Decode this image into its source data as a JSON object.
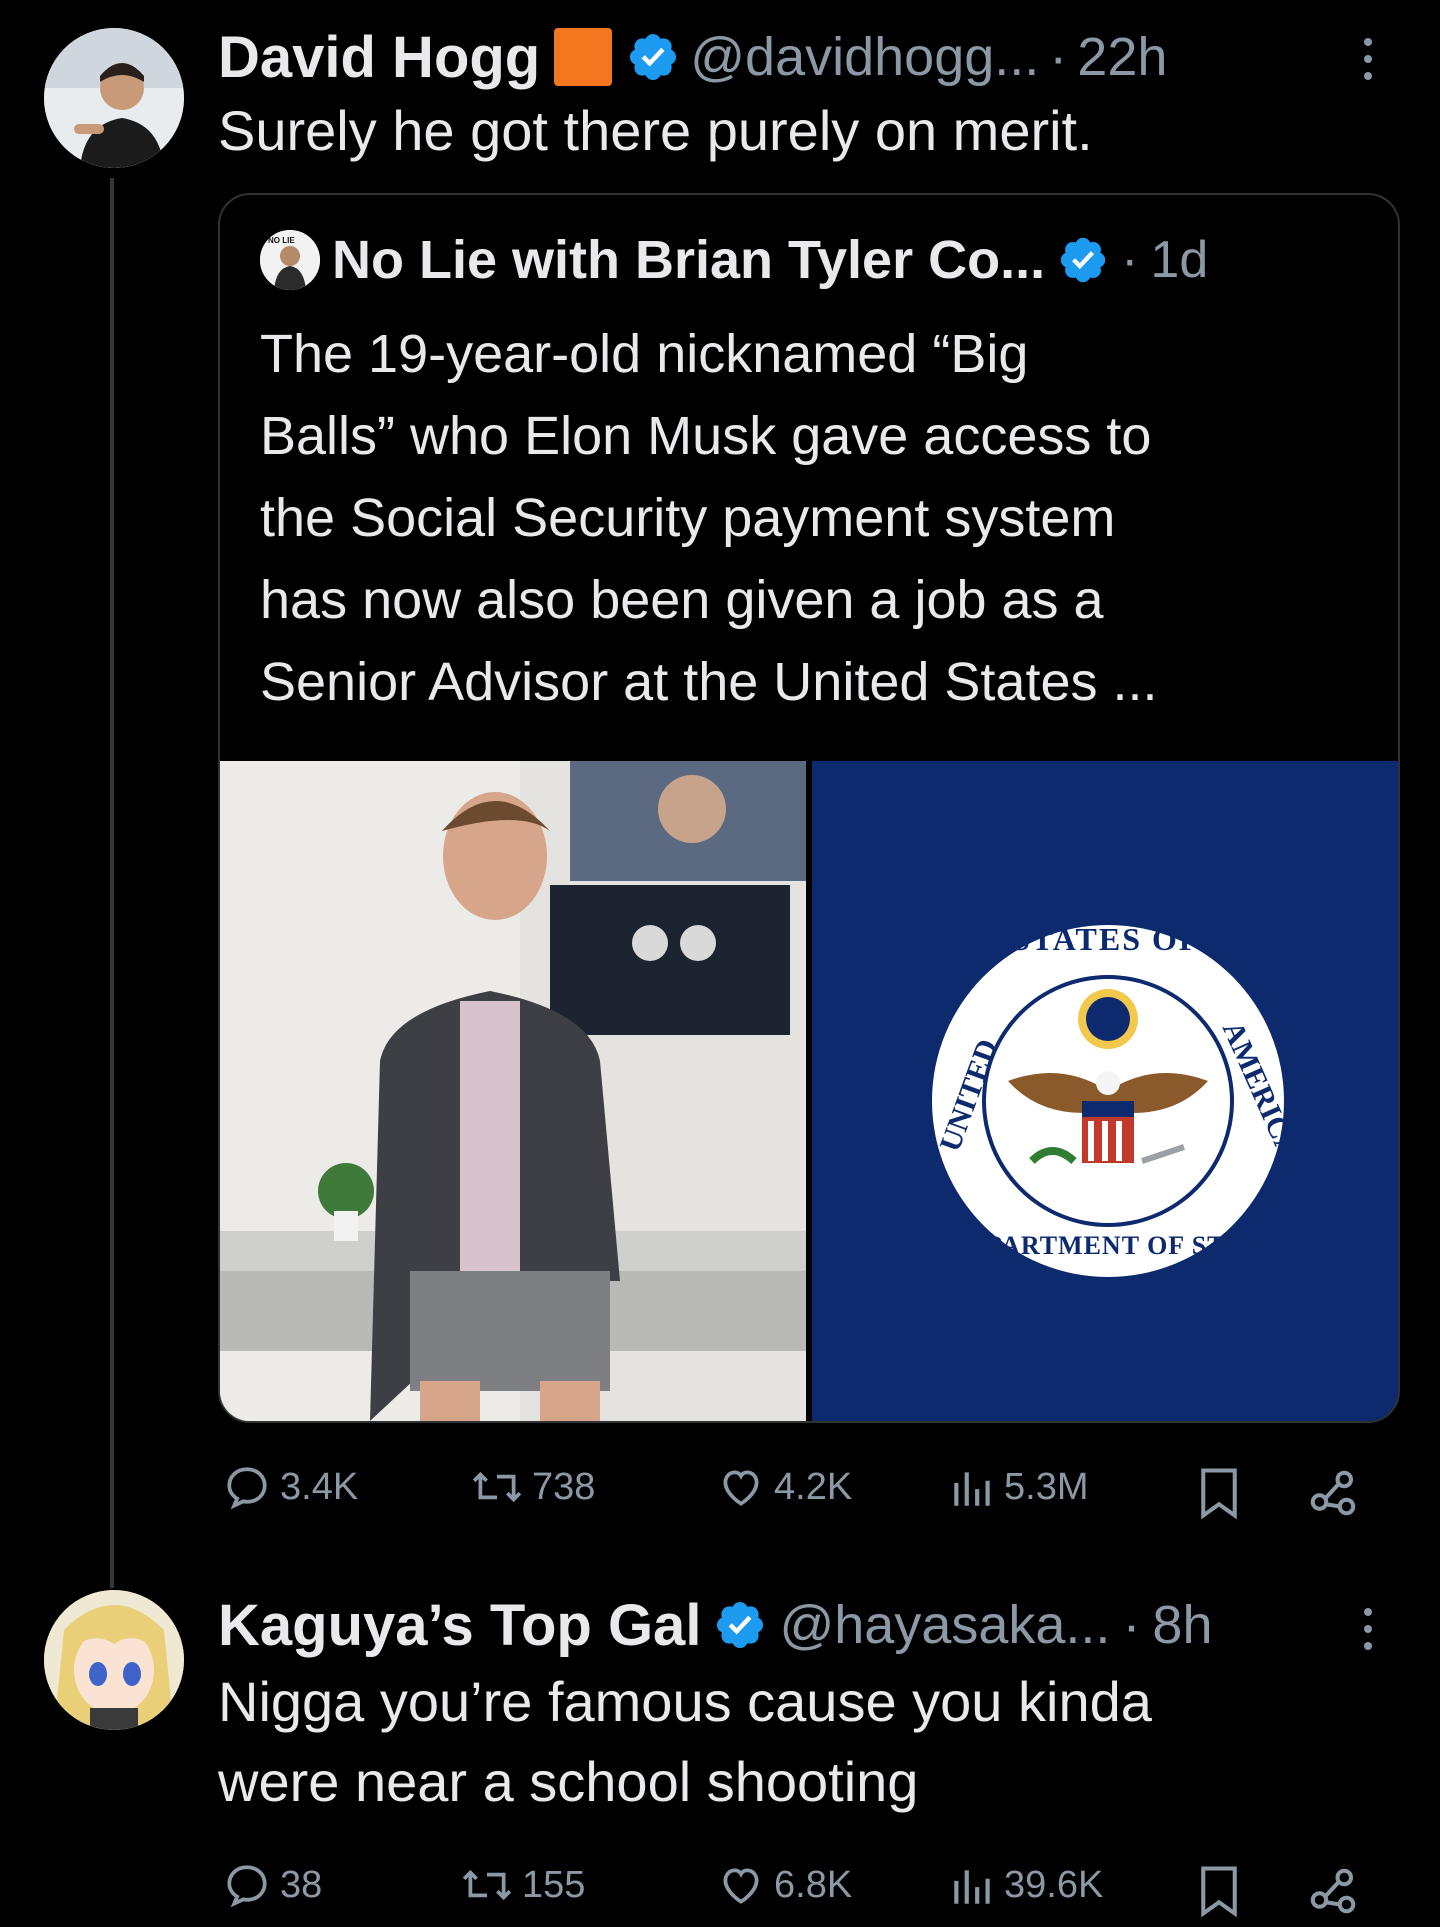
{
  "post1": {
    "author": "David Hogg",
    "flag_color": "#f4761f",
    "verified": true,
    "handle": "@davidhogg...",
    "dot": "·",
    "time": "22h",
    "text": "Surely he got there purely on merit.",
    "quote": {
      "author": "No Lie with Brian Tyler Co...",
      "dot": "·",
      "time": "1d",
      "avatar_text": "NO LIE",
      "text_lines": [
        "The 19-year-old nicknamed “Big",
        "Balls” who Elon Musk gave access to",
        "the Social Security payment system",
        "has now also been given a job as a",
        "Senior Advisor at the United States ..."
      ],
      "seal_text_top": "STATES OF",
      "seal_text_left": "UNITED",
      "seal_text_right": "AMERICA",
      "seal_text_bottom": "DEPARTMENT OF STATE",
      "seal_color": "#0c2a6d"
    },
    "stats": {
      "replies": "3.4K",
      "reposts": "738",
      "likes": "4.2K",
      "views": "5.3M"
    }
  },
  "post2": {
    "author": "Kaguya’s Top Gal",
    "verified": true,
    "handle": "@hayasaka...",
    "dot": "·",
    "time": "8h",
    "text_lines": [
      "Nigga you’re famous cause you kinda",
      "were near a school shooting"
    ],
    "stats": {
      "replies": "38",
      "reposts": "155",
      "likes": "6.8K",
      "views": "39.6K"
    }
  },
  "colors": {
    "verified_blue": "#1d9bf0",
    "text": "#e7e9ea",
    "muted": "#8b98a5"
  }
}
